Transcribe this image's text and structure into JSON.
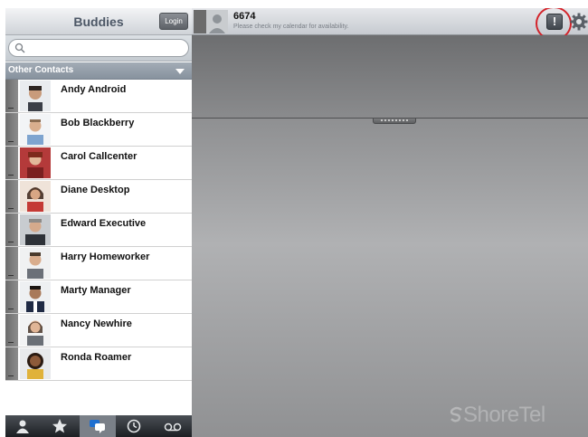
{
  "sidebar": {
    "title": "Buddies",
    "login_label": "Login",
    "search": {
      "placeholder": ""
    },
    "section": {
      "title": "Other Contacts"
    },
    "contacts": [
      {
        "name": "Andy Android"
      },
      {
        "name": "Bob Blackberry"
      },
      {
        "name": "Carol Callcenter"
      },
      {
        "name": "Diane Desktop"
      },
      {
        "name": "Edward Executive"
      },
      {
        "name": "Harry Homeworker"
      },
      {
        "name": "Marty Manager"
      },
      {
        "name": "Nancy Newhire"
      },
      {
        "name": "Ronda Roamer"
      }
    ],
    "tabs": [
      "contacts-icon",
      "favorites-icon",
      "chat-icon",
      "history-icon",
      "voicemail-icon"
    ]
  },
  "topbar": {
    "extension": "6674",
    "status": "Please check my calendar for availability."
  },
  "watermark": "ShoreTel",
  "colors": {
    "alert_highlight": "#d3242b",
    "section_header": "#97a1ac"
  }
}
